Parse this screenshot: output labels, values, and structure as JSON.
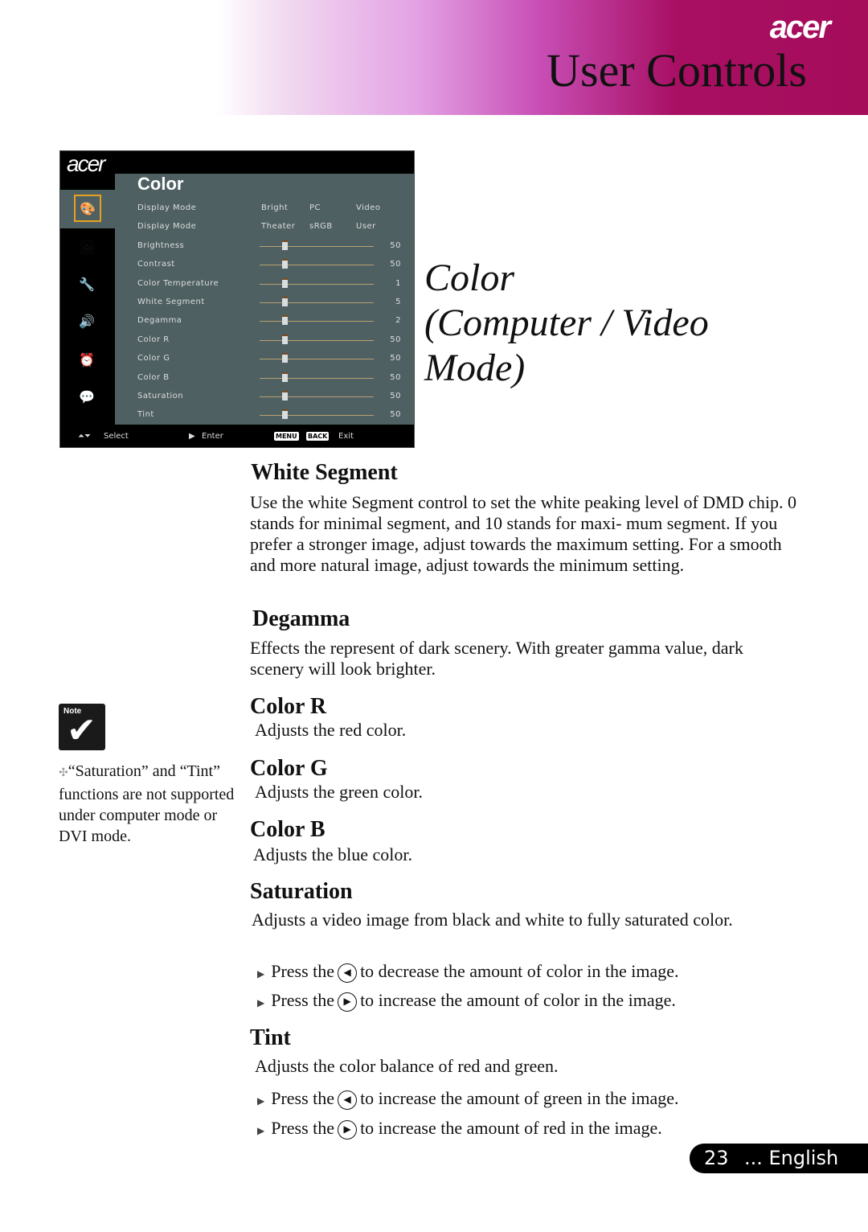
{
  "header": {
    "brand": "acer",
    "title": "User Controls",
    "accent_color": "#a50c5a"
  },
  "osd": {
    "logo": "acer",
    "title": "Color",
    "side_icons": [
      "color-palette-icon",
      "image-icon",
      "settings-wrench-icon",
      "speaker-icon",
      "timer-icon",
      "language-icon"
    ],
    "mode_rows": [
      {
        "label": "Display Mode",
        "options": [
          "Bright",
          "PC",
          "Video"
        ]
      },
      {
        "label": "Display Mode",
        "options": [
          "Theater",
          "sRGB",
          "User"
        ]
      }
    ],
    "slider_rows": [
      {
        "label": "Brightness",
        "value": "50"
      },
      {
        "label": "Contrast",
        "value": "50"
      },
      {
        "label": "Color Temperature",
        "value": "1"
      },
      {
        "label": "White Segment",
        "value": "5"
      },
      {
        "label": "Degamma",
        "value": "2"
      },
      {
        "label": "Color R",
        "value": "50"
      },
      {
        "label": "Color G",
        "value": "50"
      },
      {
        "label": "Color B",
        "value": "50"
      },
      {
        "label": "Saturation",
        "value": "50"
      },
      {
        "label": "Tint",
        "value": "50"
      }
    ],
    "footer": {
      "select": "Select",
      "enter": "Enter",
      "menu_key": "MENU",
      "back_key": "BACK",
      "exit": "Exit"
    }
  },
  "big_title": [
    "Color",
    "(Computer / Video",
    "Mode)"
  ],
  "sections": {
    "white_segment": {
      "heading": "White Segment",
      "body": "Use the white Segment control to set the white peaking level of DMD chip. 0 stands for minimal segment, and 10 stands for maxi- mum segment.  If you prefer a stronger image, adjust towards the maximum setting.  For a smooth and more natural image, adjust towards the minimum setting."
    },
    "degamma": {
      "heading": "Degamma",
      "body": "Effects the represent of dark scenery.  With greater gamma value, dark scenery will look brighter."
    },
    "color_r": {
      "heading": "Color R",
      "body": "Adjusts the red color."
    },
    "color_g": {
      "heading": "Color G",
      "body": "Adjusts the green color."
    },
    "color_b": {
      "heading": "Color B",
      "body": "Adjusts the blue color."
    },
    "saturation": {
      "heading": "Saturation",
      "body": "Adjusts a video image from black and white to fully saturated color.",
      "bullets": [
        {
          "pre": "Press the",
          "button": "left",
          "post": "to decrease the amount of color in the image."
        },
        {
          "pre": "Press the",
          "button": "right",
          "post": "to increase the amount of color in the image."
        }
      ]
    },
    "tint": {
      "heading": "Tint",
      "body": "Adjusts the color balance of red and green.",
      "bullets": [
        {
          "pre": "Press the",
          "button": "left",
          "post": "to increase the amount of green in the image."
        },
        {
          "pre": "Press the",
          "button": "right",
          "post": "to increase the amount of red  in the image."
        }
      ]
    }
  },
  "note": {
    "label": "Note",
    "text": "“Saturation” and “Tint” functions are not supported under computer mode or DVI mode."
  },
  "footer": {
    "page": "23",
    "language": "... English"
  }
}
